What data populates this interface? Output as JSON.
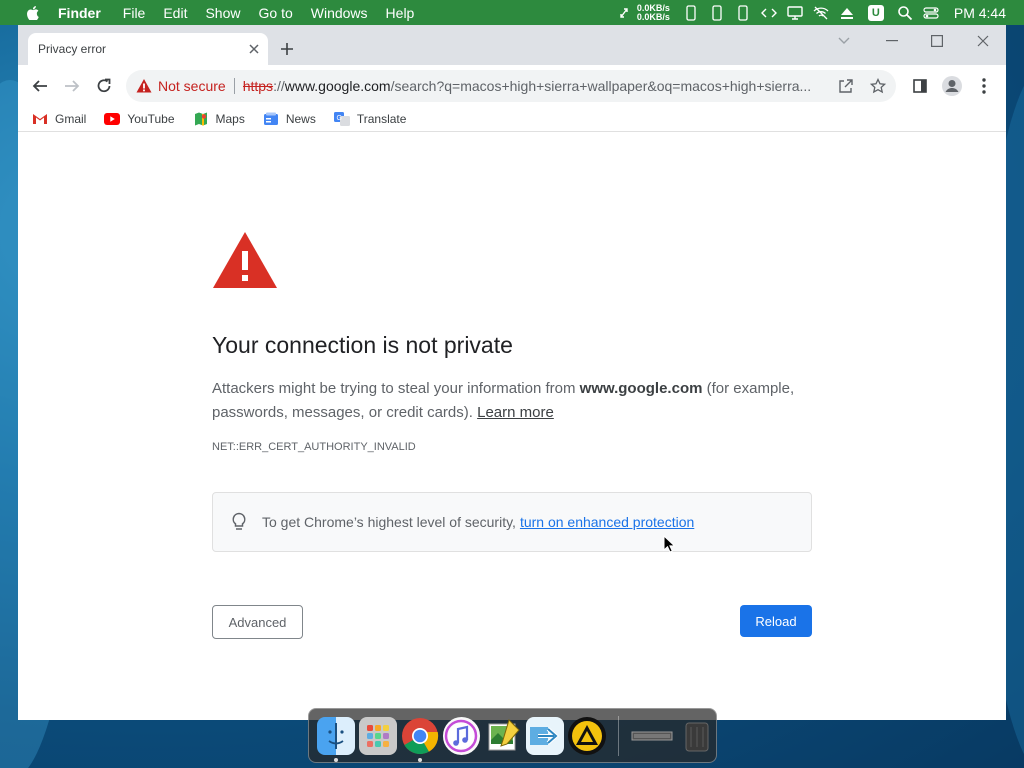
{
  "menubar": {
    "app_name": "Finder",
    "menus": [
      "File",
      "Edit",
      "Show",
      "Go to",
      "Windows",
      "Help"
    ],
    "net_up": "0.0KB/s",
    "net_down": "0.0KB/s",
    "u_badge": "U",
    "clock": "PM 4:44",
    "color": "#2d8a3e"
  },
  "tab": {
    "title": "Privacy error"
  },
  "omnibox": {
    "security_label": "Not secure",
    "url_scheme": "https",
    "url_sep": "://",
    "url_host": "www.google.com",
    "url_rest": "/search?q=macos+high+sierra+wallpaper&oq=macos+high+sierra..."
  },
  "bookmarks": [
    {
      "label": "Gmail",
      "icon": "gmail-icon"
    },
    {
      "label": "YouTube",
      "icon": "youtube-icon"
    },
    {
      "label": "Maps",
      "icon": "maps-icon"
    },
    {
      "label": "News",
      "icon": "news-icon"
    },
    {
      "label": "Translate",
      "icon": "translate-icon"
    }
  ],
  "error": {
    "title": "Your connection is not private",
    "body_pre": "Attackers might be trying to steal your information from ",
    "body_host": "www.google.com",
    "body_post": " (for example, passwords, messages, or credit cards).",
    "learn_more": "Learn more",
    "code": "NET::ERR_CERT_AUTHORITY_INVALID",
    "tip_text": "To get Chrome’s highest level of security,",
    "tip_link": "turn on enhanced protection",
    "advanced": "Advanced",
    "reload": "Reload"
  },
  "dock": {
    "apps": [
      "finder",
      "launchpad",
      "chrome",
      "itunes",
      "preview",
      "migration-assistant",
      "transmit"
    ]
  },
  "colors": {
    "accent": "#1a73e8",
    "danger": "#c5221f",
    "warning_icon": "#d93025"
  }
}
